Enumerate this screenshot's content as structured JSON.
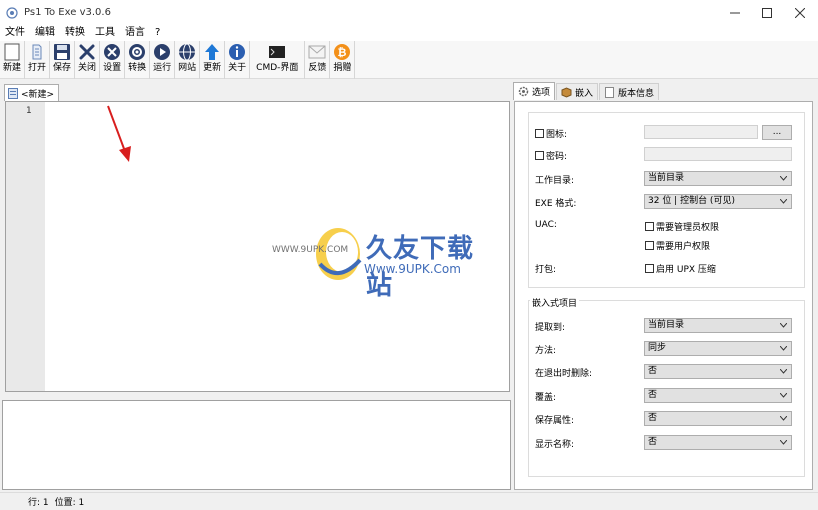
{
  "window": {
    "title": "Ps1 To Exe v3.0.6"
  },
  "menu": [
    {
      "label": "文件"
    },
    {
      "label": "编辑"
    },
    {
      "label": "转换"
    },
    {
      "label": "工具"
    },
    {
      "label": "语言"
    },
    {
      "label": "?"
    }
  ],
  "toolbar": [
    {
      "label": "新建",
      "icon": "new-file-icon"
    },
    {
      "label": "打开",
      "icon": "open-icon"
    },
    {
      "label": "保存",
      "icon": "save-icon"
    },
    {
      "label": "关闭",
      "icon": "close-icon"
    },
    {
      "label": "设置",
      "icon": "settings-icon"
    },
    {
      "label": "转换",
      "icon": "convert-icon"
    },
    {
      "label": "运行",
      "icon": "run-icon"
    },
    {
      "label": "网站",
      "icon": "globe-icon"
    },
    {
      "label": "更新",
      "icon": "update-icon"
    },
    {
      "label": "关于",
      "icon": "info-icon"
    },
    {
      "label": "CMD-界面",
      "icon": "cmd-icon"
    },
    {
      "label": "反馈",
      "icon": "mail-icon"
    },
    {
      "label": "捐赠",
      "icon": "bitcoin-icon"
    }
  ],
  "editor": {
    "tab_label": "<新建>",
    "line_number": "1"
  },
  "status": {
    "line": "行: 1",
    "position": "位置: 1"
  },
  "right_tabs": [
    {
      "label": "选项",
      "icon": "gear-icon"
    },
    {
      "label": "嵌入",
      "icon": "box-icon"
    },
    {
      "label": "版本信息",
      "icon": "doc-icon"
    }
  ],
  "options": {
    "icon_label": "图标:",
    "browse_label": "...",
    "password_label": "密码:",
    "workdir_label": "工作目录:",
    "workdir_value": "当前目录",
    "exe_format_label": "EXE 格式:",
    "exe_format_value": "32 位 | 控制台 (可见)",
    "uac_label": "UAC:",
    "uac_admin": "需要管理员权限",
    "uac_user": "需要用户权限",
    "pack_label": "打包:",
    "upx_label": "启用 UPX 压缩"
  },
  "embedded": {
    "title": "嵌入式项目",
    "extract_label": "提取到:",
    "extract_value": "当前目录",
    "method_label": "方法:",
    "method_value": "同步",
    "delete_label": "在退出时删除:",
    "delete_value": "否",
    "overwrite_label": "覆盖:",
    "overwrite_value": "否",
    "keep_attr_label": "保存属性:",
    "keep_attr_value": "否",
    "show_name_label": "显示名称:",
    "show_name_value": "否"
  },
  "watermark": {
    "brand": "久友下载站",
    "url": "Www.9UPK.Com",
    "small": "WWW.9UPK.COM"
  },
  "colors": {
    "watermark_blue": "#2f5fb3",
    "annotation_red": "#d81e1e"
  }
}
